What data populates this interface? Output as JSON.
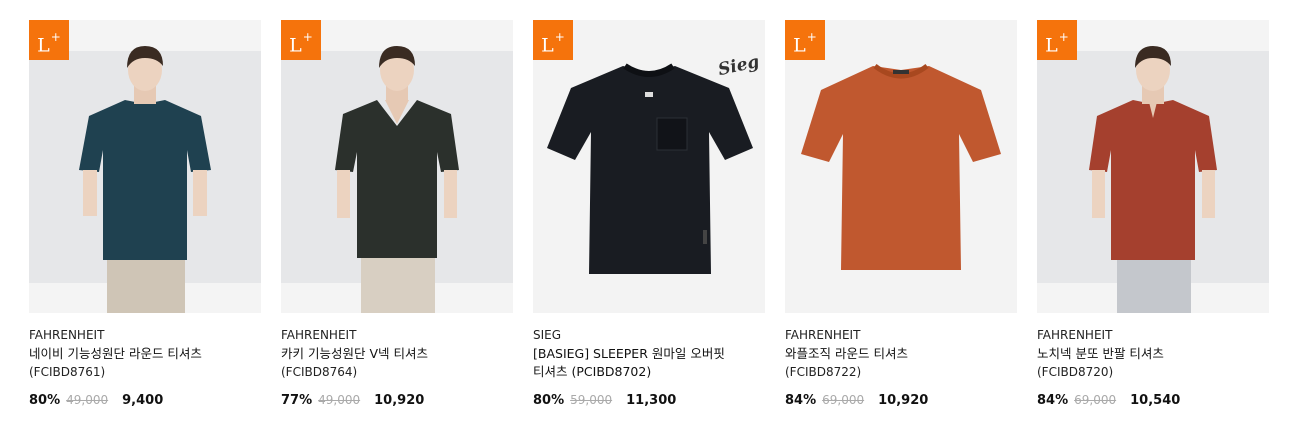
{
  "badge": {
    "letter": "L",
    "plus": "+"
  },
  "products": [
    {
      "brand": "FAHRENHEIT",
      "name": "네이비 기능성원단 라운드 티셔츠",
      "code": "(FCIBD8761)",
      "discount": "80%",
      "original_price": "49,000",
      "sale_price": "9,400",
      "shirt_color": "#1f4150",
      "neck": "round"
    },
    {
      "brand": "FAHRENHEIT",
      "name": "카키 기능성원단 V넥 티셔츠",
      "code": "(FCIBD8764)",
      "discount": "77%",
      "original_price": "49,000",
      "sale_price": "10,920",
      "shirt_color": "#2b302c",
      "neck": "v"
    },
    {
      "brand": "SIEG",
      "name": "[BASIEG] SLEEPER 원마일 오버핏",
      "name_line2": "티셔츠",
      "code": "(PCIBD8702)",
      "discount": "80%",
      "original_price": "59,000",
      "sale_price": "11,300",
      "shirt_color": "#191c22",
      "logo": "Sieg"
    },
    {
      "brand": "FAHRENHEIT",
      "name": "와플조직 라운드 티셔츠",
      "code": "(FCIBD8722)",
      "discount": "84%",
      "original_price": "69,000",
      "sale_price": "10,920",
      "shirt_color": "#c0582f"
    },
    {
      "brand": "FAHRENHEIT",
      "name": "노치넥 분또 반팔 티셔츠",
      "code": "(FCIBD8720)",
      "discount": "84%",
      "original_price": "69,000",
      "sale_price": "10,540",
      "shirt_color": "#a5402e",
      "neck": "notch"
    }
  ]
}
